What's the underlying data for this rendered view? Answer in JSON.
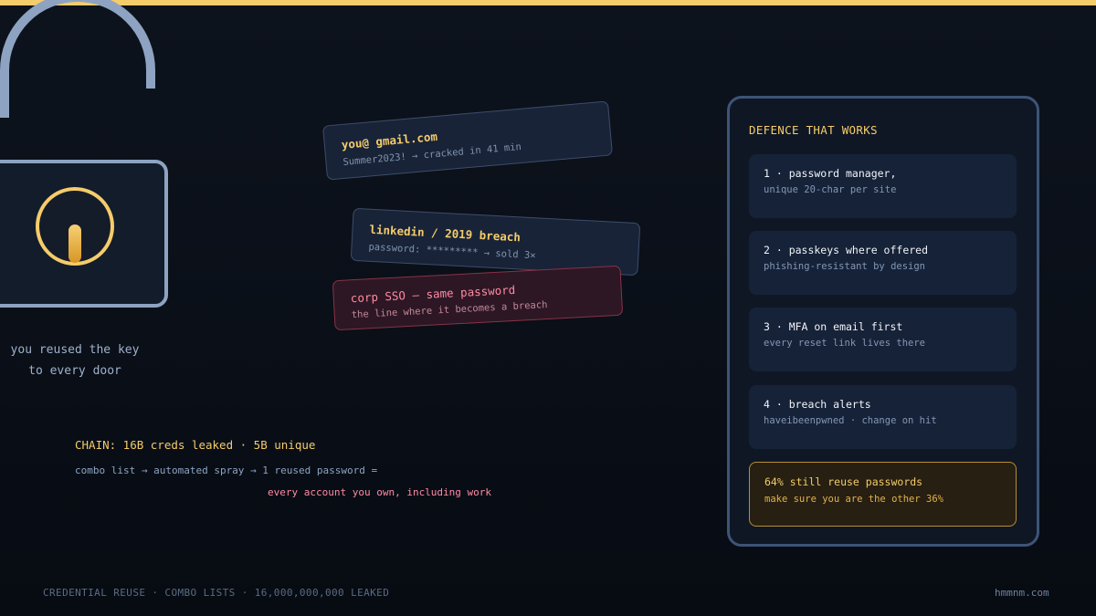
{
  "colors": {
    "accent": "#f5cc6a",
    "danger": "#ff8aa4",
    "background": "#0a0f18",
    "lock": "#8ea3c2"
  },
  "lock": {
    "icon": "padlock-open-icon",
    "caption_line1": "you reused the key",
    "caption_line2": "to every door"
  },
  "cards": [
    {
      "title": "you@ gmail.com",
      "sub": "Summer2023! → cracked in 41 min"
    },
    {
      "title": "linkedin / 2019 breach",
      "sub": "password: ********* → sold 3×"
    },
    {
      "title": "corp SSO — same password",
      "sub": "the line where it becomes a breach"
    }
  ],
  "chain": {
    "title": "CHAIN: 16B creds leaked · 5B unique",
    "flow": "combo list → automated spray → 1 reused password =",
    "result": "every account you own, including work"
  },
  "panel": {
    "title": "DEFENCE THAT WORKS",
    "items": [
      {
        "title": "1 · password manager,",
        "sub": "unique 20-char per site"
      },
      {
        "title": "2 · passkeys where offered",
        "sub": "phishing-resistant by design"
      },
      {
        "title": "3 · MFA on email first",
        "sub": "every reset link lives there"
      },
      {
        "title": "4 · breach alerts",
        "sub": "haveibeenpwned · change on hit"
      }
    ],
    "stat": {
      "title": "64% still reuse passwords",
      "sub": "make sure you are the other 36%"
    }
  },
  "footer": {
    "left": "CREDENTIAL REUSE · COMBO LISTS · 16,000,000,000 LEAKED",
    "right": "hmmnm.com"
  }
}
